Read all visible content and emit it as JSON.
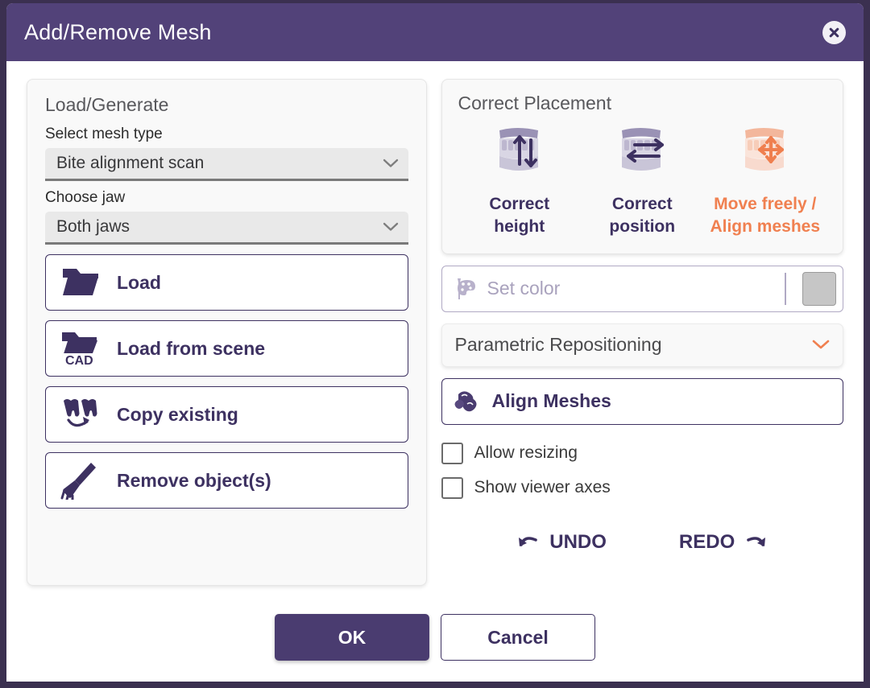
{
  "window": {
    "title": "Add/Remove Mesh",
    "close_icon": "close-circle-icon",
    "titlebar_color": "#524279",
    "frame_color": "#3b3050"
  },
  "left_panel": {
    "title": "Load/Generate",
    "mesh_type": {
      "label": "Select mesh type",
      "value": "Bite alignment scan",
      "chevron_icon": "chevron-down-icon"
    },
    "jaw": {
      "label": "Choose jaw",
      "value": "Both jaws",
      "chevron_icon": "chevron-down-icon"
    },
    "buttons": [
      {
        "label": "Load",
        "icon": "folder-open-icon"
      },
      {
        "label": "Load from scene",
        "icon": "folder-cad-icon"
      },
      {
        "label": "Copy existing",
        "icon": "copy-tooth-icon"
      },
      {
        "label": "Remove object(s)",
        "icon": "broom-icon"
      }
    ]
  },
  "right_panel": {
    "placement": {
      "title": "Correct Placement",
      "options": [
        {
          "label": "Correct\nheight",
          "line1": "Correct",
          "line2": "height",
          "icon": "jaw-vertical-arrows-icon",
          "active": false
        },
        {
          "label": "Correct\nposition",
          "line1": "Correct",
          "line2": "position",
          "icon": "jaw-horizontal-arrows-icon",
          "active": false
        },
        {
          "label": "Move freely / Align meshes",
          "line1": "Move freely /",
          "line2": "Align meshes",
          "icon": "jaw-move-arrows-icon",
          "active": true
        }
      ],
      "active_color": "#f08050",
      "inactive_color": "#3d3161"
    },
    "set_color": {
      "label": "Set color",
      "icon": "palette-icon",
      "swatch_color": "#c6c6c6"
    },
    "parametric": {
      "label": "Parametric Repositioning",
      "chevron_icon": "chevron-down-icon",
      "chevron_color": "#f08050"
    },
    "align_meshes": {
      "label": "Align Meshes",
      "icon": "align-meshes-icon"
    },
    "checkboxes": [
      {
        "label": "Allow resizing",
        "checked": false
      },
      {
        "label": "Show viewer axes",
        "checked": false
      }
    ],
    "undo": {
      "label": "UNDO",
      "icon": "undo-arrow-icon"
    },
    "redo": {
      "label": "REDO",
      "icon": "redo-arrow-icon"
    }
  },
  "footer": {
    "ok_label": "OK",
    "cancel_label": "Cancel"
  }
}
